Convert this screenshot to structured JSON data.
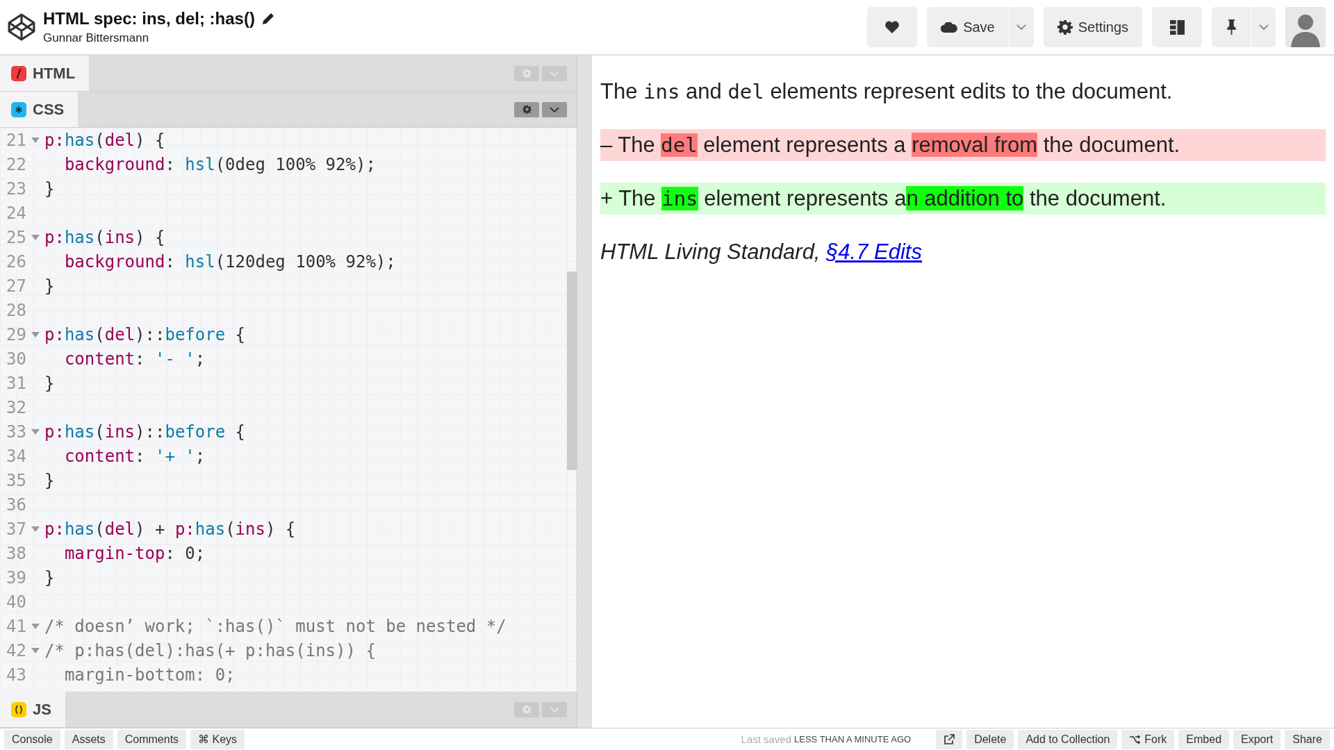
{
  "header": {
    "title": "HTML spec: ins, del; :has()",
    "author": "Gunnar Bittersmann",
    "buttons": [
      {
        "kind": "heart"
      },
      {
        "kind": "save",
        "label": "Save"
      },
      {
        "kind": "settings",
        "label": "Settings"
      },
      {
        "kind": "layout"
      },
      {
        "kind": "pin"
      }
    ]
  },
  "panels": [
    {
      "kind": "html",
      "label": "HTML",
      "expanded": false
    },
    {
      "kind": "css",
      "label": "CSS",
      "expanded": true
    }
  ],
  "code_lines": [
    {
      "n": "21",
      "fold": true,
      "tokens": [
        {
          "kind": "sel",
          "text": "p:"
        },
        {
          "kind": "fn",
          "text": "has"
        },
        {
          "kind": "plain",
          "text": "("
        },
        {
          "kind": "sel",
          "text": "del"
        },
        {
          "kind": "plain",
          "text": ") {"
        }
      ]
    },
    {
      "n": "22",
      "fold": false,
      "tokens": [
        {
          "kind": "sel",
          "text": "  background"
        },
        {
          "kind": "plain",
          "text": ": "
        },
        {
          "kind": "fn",
          "text": "hsl"
        },
        {
          "kind": "plain",
          "text": "(0deg 100% 92%);"
        }
      ]
    },
    {
      "n": "23",
      "fold": false,
      "tokens": [
        {
          "kind": "plain",
          "text": "}"
        }
      ]
    },
    {
      "n": "24",
      "fold": false
    },
    {
      "n": "25",
      "fold": true,
      "tokens": [
        {
          "kind": "sel",
          "text": "p:"
        },
        {
          "kind": "fn",
          "text": "has"
        },
        {
          "kind": "plain",
          "text": "("
        },
        {
          "kind": "sel",
          "text": "ins"
        },
        {
          "kind": "plain",
          "text": ") {"
        }
      ]
    },
    {
      "n": "26",
      "fold": false,
      "tokens": [
        {
          "kind": "sel",
          "text": "  background"
        },
        {
          "kind": "plain",
          "text": ": "
        },
        {
          "kind": "fn",
          "text": "hsl"
        },
        {
          "kind": "plain",
          "text": "(120deg 100% 92%);"
        }
      ]
    },
    {
      "n": "27",
      "fold": false,
      "tokens": [
        {
          "kind": "plain",
          "text": "}"
        }
      ]
    },
    {
      "n": "28",
      "fold": false
    },
    {
      "n": "29",
      "fold": true,
      "tokens": [
        {
          "kind": "sel",
          "text": "p:"
        },
        {
          "kind": "fn",
          "text": "has"
        },
        {
          "kind": "plain",
          "text": "("
        },
        {
          "kind": "sel",
          "text": "del"
        },
        {
          "kind": "plain",
          "text": ")::"
        },
        {
          "kind": "fn",
          "text": "before"
        },
        {
          "kind": "plain",
          "text": " {"
        }
      ]
    },
    {
      "n": "30",
      "fold": false,
      "tokens": [
        {
          "kind": "sel",
          "text": "  content"
        },
        {
          "kind": "plain",
          "text": ": "
        },
        {
          "kind": "fn",
          "text": "'- '"
        },
        {
          "kind": "plain",
          "text": ";"
        }
      ]
    },
    {
      "n": "31",
      "fold": false,
      "tokens": [
        {
          "kind": "plain",
          "text": "}"
        }
      ]
    },
    {
      "n": "32",
      "fold": false
    },
    {
      "n": "33",
      "fold": true,
      "tokens": [
        {
          "kind": "sel",
          "text": "p:"
        },
        {
          "kind": "fn",
          "text": "has"
        },
        {
          "kind": "plain",
          "text": "("
        },
        {
          "kind": "sel",
          "text": "ins"
        },
        {
          "kind": "plain",
          "text": ")::"
        },
        {
          "kind": "fn",
          "text": "before"
        },
        {
          "kind": "plain",
          "text": " {"
        }
      ]
    },
    {
      "n": "34",
      "fold": false,
      "tokens": [
        {
          "kind": "sel",
          "text": "  content"
        },
        {
          "kind": "plain",
          "text": ": "
        },
        {
          "kind": "fn",
          "text": "'+ '"
        },
        {
          "kind": "plain",
          "text": ";"
        }
      ]
    },
    {
      "n": "35",
      "fold": false,
      "tokens": [
        {
          "kind": "plain",
          "text": "}"
        }
      ]
    },
    {
      "n": "36",
      "fold": false
    },
    {
      "n": "37",
      "fold": true,
      "tokens": [
        {
          "kind": "sel",
          "text": "p:"
        },
        {
          "kind": "fn",
          "text": "has"
        },
        {
          "kind": "plain",
          "text": "("
        },
        {
          "kind": "sel",
          "text": "del"
        },
        {
          "kind": "plain",
          "text": ") + "
        },
        {
          "kind": "sel",
          "text": "p:"
        },
        {
          "kind": "fn",
          "text": "has"
        },
        {
          "kind": "plain",
          "text": "("
        },
        {
          "kind": "sel",
          "text": "ins"
        },
        {
          "kind": "plain",
          "text": ") {"
        }
      ]
    },
    {
      "n": "38",
      "fold": false,
      "tokens": [
        {
          "kind": "sel",
          "text": "  margin-top"
        },
        {
          "kind": "plain",
          "text": ": 0;"
        }
      ]
    },
    {
      "n": "39",
      "fold": false,
      "tokens": [
        {
          "kind": "plain",
          "text": "}"
        }
      ]
    },
    {
      "n": "40",
      "fold": false
    },
    {
      "n": "41",
      "fold": true,
      "tokens": [
        {
          "kind": "comment",
          "text": "/* doesn’ work; `:has()` must not be nested */"
        }
      ]
    },
    {
      "n": "42",
      "fold": true,
      "tokens": [
        {
          "kind": "comment",
          "text": "/* p:has(del):has(+ p:has(ins)) {"
        }
      ]
    },
    {
      "n": "43",
      "fold": false,
      "tokens": [
        {
          "kind": "comment",
          "text": "  margin-bottom: 0;"
        }
      ]
    }
  ],
  "js_panel": {
    "kind": "js",
    "label": "JS",
    "expanded": false
  },
  "preview": [
    {
      "kind": "plain",
      "segments": [
        {
          "kind": "text",
          "text": "The "
        },
        {
          "kind": "code",
          "text": "ins"
        },
        {
          "kind": "text",
          "text": " and "
        },
        {
          "kind": "code",
          "text": "del"
        },
        {
          "kind": "text",
          "text": " elements represent edits to the document."
        }
      ]
    },
    {
      "kind": "del",
      "segments": [
        {
          "kind": "text",
          "text": "– The "
        },
        {
          "kind": "code-del",
          "text": "del"
        },
        {
          "kind": "text",
          "text": " element represents a "
        },
        {
          "kind": "del",
          "text": "removal from"
        },
        {
          "kind": "text",
          "text": " the document."
        }
      ]
    },
    {
      "kind": "ins",
      "segments": [
        {
          "kind": "text",
          "text": "+ The "
        },
        {
          "kind": "code-ins",
          "text": "ins"
        },
        {
          "kind": "text",
          "text": " element represents a"
        },
        {
          "kind": "ins",
          "text": "n addition to"
        },
        {
          "kind": "text",
          "text": " the document."
        }
      ]
    },
    {
      "kind": "cite",
      "segments": [
        {
          "kind": "text",
          "text": "HTML Living Standard, "
        },
        {
          "kind": "link",
          "text": "§4.7 Edits"
        }
      ]
    }
  ],
  "footer": {
    "left": [
      {
        "label": "Console"
      },
      {
        "label": "Assets"
      },
      {
        "label": "Comments"
      },
      {
        "label": "⌘ Keys"
      }
    ],
    "last_saved_label": "Last saved",
    "last_saved_time": "LESS THAN A MINUTE AGO",
    "right": [
      {
        "kind": "external"
      },
      {
        "kind": "text",
        "label": "Delete"
      },
      {
        "kind": "text",
        "label": "Add to Collection"
      },
      {
        "kind": "fork",
        "label": "Fork"
      },
      {
        "kind": "text",
        "label": "Embed"
      },
      {
        "kind": "text",
        "label": "Export"
      },
      {
        "kind": "text",
        "label": "Share"
      }
    ]
  }
}
